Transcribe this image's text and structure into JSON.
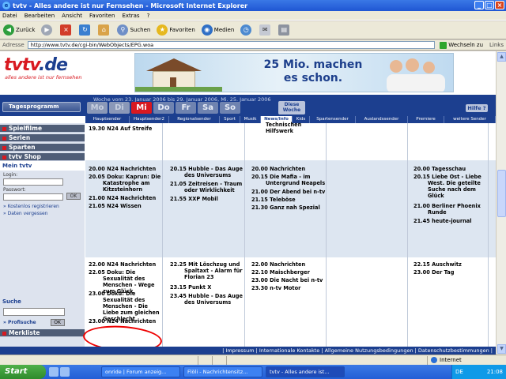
{
  "window": {
    "title": "tvtv - Alles andere ist nur Fernsehen - Microsoft Internet Explorer"
  },
  "menu": [
    "Datei",
    "Bearbeiten",
    "Ansicht",
    "Favoriten",
    "Extras",
    "?"
  ],
  "toolbar": {
    "back": "Zurück",
    "search": "Suchen",
    "favorites": "Favoriten",
    "media": "Medien"
  },
  "address": {
    "label": "Adresse",
    "url": "http://www.tvtv.de/cgi-bin/WebObjects/EPG.woa",
    "go": "Wechseln zu",
    "links": "Links"
  },
  "site": {
    "logo_a": "tvtv",
    "logo_b": ".de",
    "slogan": "alles andere ist nur fernsehen",
    "banner_line1": "25 Mio. machen",
    "banner_line2": "es schon.",
    "week_range": "Woche vom 23. Januar 2006 bis 29. Januar 2006, Mi. 25. Januar 2006",
    "tagesprogramm": "Tagesprogramm",
    "days": [
      "Mo",
      "Di",
      "Mi",
      "Do",
      "Fr",
      "Sa",
      "So"
    ],
    "diese_woche_1": "Diese",
    "diese_woche_2": "Woche",
    "hilfe": "Hilfe ?",
    "channels": [
      "Hauptsender",
      "Hauptsender2",
      "Regionalsender",
      "Sport",
      "Musik",
      "News/Info",
      "Kids",
      "Spartensender",
      "Auslandssender",
      "Premiere",
      "weitere Sender"
    ]
  },
  "sidebar": {
    "items": [
      "Spielfilme",
      "Serien",
      "Sparten",
      "tvtv Shop"
    ],
    "mein_tvtv": "Mein tvtv",
    "login_label": "Login:",
    "password_label": "Passwort:",
    "ok": "OK",
    "link_register": "» Kostenlos registrieren",
    "link_forgot": "» Daten vergessen",
    "suche": "Suche",
    "profisuche": "» Profisuche",
    "merkliste": "Merkliste"
  },
  "program": {
    "col1": [
      "19.30 N24 Auf Streife",
      "20.00 N24 Nachrichten",
      "20.05 Doku: Kaprun: Die Katastrophe am Kitzsteinhorn",
      "21.00 N24 Nachrichten",
      "21.05 N24 Wissen",
      "22.00 N24 Nachrichten",
      "22.05 Doku: Die Sexualität des Menschen - Wege zum Glück",
      "23.00 Doku: Die Sexualität des Menschen - Die Liebe zum gleichen Geschlecht",
      "23.00 N24 Nachrichten"
    ],
    "col2": [
      "20.15 Hubble - Das Auge des Universums",
      "21.05 Zeitreisen - Traum oder Wirklichkeit",
      "21.55 XXP Mobil",
      "22.25 Mit Löschzug und Spaltaxt - Alarm für Florian 23",
      "23.15 Punkt X",
      "23.45 Hubble - Das Auge des Universums"
    ],
    "col3": [
      "Technischen",
      "Hilfswerk",
      "20.00 Nachrichten",
      "20.15 Die Mafia - im Untergrund Neapels",
      "21.00 Der Abend bei n-tv",
      "21.15 Teleböse",
      "21.30 Ganz nah Spezial",
      "22.00 Nachrichten",
      "22.10 Maischberger",
      "23.00 Die Nacht bei n-tv",
      "23.30 n-tv Motor"
    ],
    "col5": [
      "20.00 Tagesschau",
      "20.15 Liebe Ost - Liebe West. Die geteilte Suche nach dem Glück",
      "21.00 Berliner Phoenix Runde",
      "21.45 heute-journal",
      "22.15 Auschwitz",
      "23.00 Der Tag"
    ]
  },
  "footer": "| Impressum | Internationale Kontakte | Allgemeine Nutzungsbedingungen | Datenschutzbestimmungen |",
  "status": {
    "zone": "Internet"
  },
  "taskbar": {
    "start": "Start",
    "tasks": [
      "onride | Forum anzeig...",
      "Flöli - Nachrichtensitz...",
      "tvtv - Alles andere ist..."
    ],
    "lang": "DE",
    "clock": "21:08"
  }
}
